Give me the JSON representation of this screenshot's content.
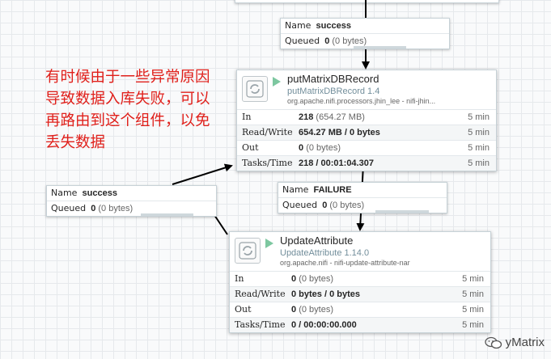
{
  "annotation": {
    "text": "有时候由于一些异常原因\n导致数据入库失败，可以\n再路由到这个组件，以免\n丢失数据"
  },
  "connections": [
    {
      "name_label": "Name",
      "name_value": "success",
      "queued_label": "Queued",
      "queued_count": "0",
      "queued_bytes": "(0 bytes)"
    },
    {
      "name_label": "Name",
      "name_value": "success",
      "queued_label": "Queued",
      "queued_count": "0",
      "queued_bytes": "(0 bytes)"
    },
    {
      "name_label": "Name",
      "name_value": "FAILURE",
      "queued_label": "Queued",
      "queued_count": "0",
      "queued_bytes": "(0 bytes)"
    }
  ],
  "processors": [
    {
      "name": "putMatrixDBRecord",
      "type": "putMatrixDBRecord 1.4",
      "bundle": "org.apache.nifi.processors.jhin_lee - nifi-jhin...",
      "status_color": "#7dc7a0",
      "stats": [
        {
          "label": "In",
          "value": "218",
          "extra": "(654.27 MB)",
          "time": "5 min"
        },
        {
          "label": "Read/Write",
          "value": "654.27 MB / 0 bytes",
          "extra": "",
          "time": "5 min"
        },
        {
          "label": "Out",
          "value": "0",
          "extra": "(0 bytes)",
          "time": "5 min"
        },
        {
          "label": "Tasks/Time",
          "value": "218 / 00:01:04.307",
          "extra": "",
          "time": "5 min"
        }
      ]
    },
    {
      "name": "UpdateAttribute",
      "type": "UpdateAttribute 1.14.0",
      "bundle": "org.apache.nifi - nifi-update-attribute-nar",
      "status_color": "#7dc7a0",
      "stats": [
        {
          "label": "In",
          "value": "0",
          "extra": "(0 bytes)",
          "time": "5 min"
        },
        {
          "label": "Read/Write",
          "value": "0 bytes / 0 bytes",
          "extra": "",
          "time": "5 min"
        },
        {
          "label": "Out",
          "value": "0",
          "extra": "(0 bytes)",
          "time": "5 min"
        },
        {
          "label": "Tasks/Time",
          "value": "0 / 00:00:00.000",
          "extra": "",
          "time": "5 min"
        }
      ]
    }
  ],
  "watermark": {
    "text": "yMatrix",
    "icon": "wechat-icon"
  }
}
